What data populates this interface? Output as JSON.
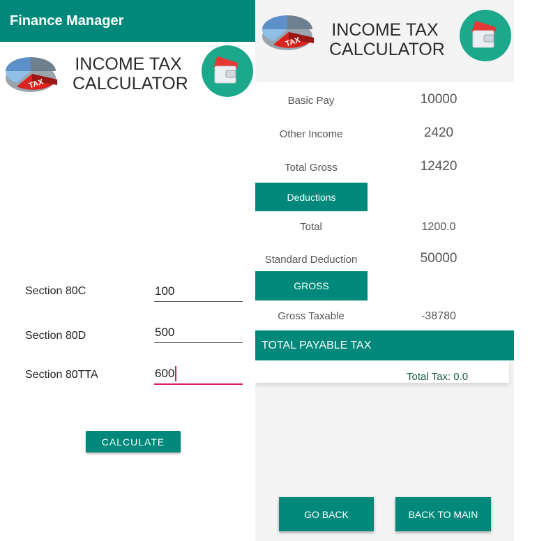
{
  "left": {
    "appbar_title": "Finance Manager",
    "header": {
      "title_line1": "INCOME TAX",
      "title_line2": "CALCULATOR",
      "pie_text": "TAX"
    },
    "fields": [
      {
        "label": "Section 80C",
        "value": "100"
      },
      {
        "label": "Section 80D",
        "value": "500"
      },
      {
        "label": "Section 80TTA",
        "value": "600"
      }
    ],
    "calculate_label": "CALCULATE"
  },
  "right": {
    "header": {
      "title_line1": "INCOME TAX",
      "title_line2": "CALCULATOR",
      "pie_text": "TAX"
    },
    "rows": [
      {
        "label": "Basic Pay",
        "value": "10000"
      },
      {
        "label": "Other Income",
        "value": "2420"
      },
      {
        "label": "Total Gross",
        "value": "12420"
      }
    ],
    "deductions_label": "Deductions",
    "deduction_rows": [
      {
        "label": "Total",
        "value": "1200.0"
      },
      {
        "label": "Standard Deduction",
        "value": "50000"
      }
    ],
    "gross_label": "GROSS",
    "gross_taxable": {
      "label": "Gross Taxable",
      "value": "-38780"
    },
    "payable_label": "TOTAL PAYABLE TAX",
    "total_tax": "Total Tax: 0.0",
    "go_back_label": "GO BACK",
    "back_to_main_label": "BACK TO MAIN"
  },
  "colors": {
    "primary": "#00897b",
    "accent": "#d81b60",
    "wallet_card": "#e53935"
  },
  "icons": {
    "tax_pie": "tax-pie-chart-icon",
    "wallet": "wallet-icon"
  }
}
